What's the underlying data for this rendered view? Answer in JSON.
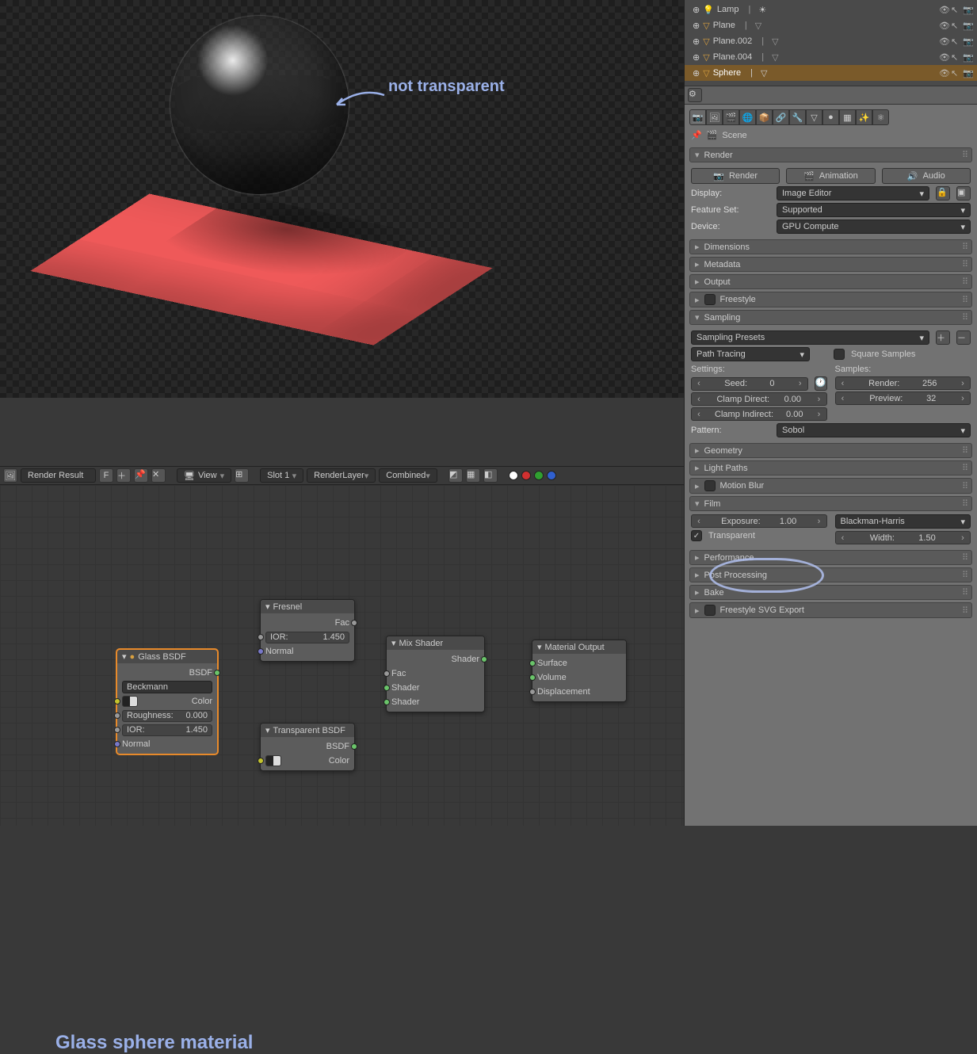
{
  "annotations": {
    "not_transparent": "not transparent",
    "material_title": "Glass sphere material"
  },
  "outliner": {
    "items": [
      {
        "name": "Lamp",
        "icon": "lamp"
      },
      {
        "name": "Plane",
        "icon": "mesh"
      },
      {
        "name": "Plane.002",
        "icon": "mesh"
      },
      {
        "name": "Plane.004",
        "icon": "mesh"
      },
      {
        "name": "Sphere",
        "icon": "mesh",
        "selected": true
      }
    ]
  },
  "node_toolbar": {
    "source_label": "Render Result",
    "f_label": "F",
    "view_label": "View",
    "slot_label": "Slot 1",
    "layer_label": "RenderLayer",
    "pass_label": "Combined"
  },
  "nodes": {
    "glass": {
      "title": "Glass BSDF",
      "out_bsdf": "BSDF",
      "distribution": "Beckmann",
      "color_label": "Color",
      "roughness_label": "Roughness:",
      "roughness_val": "0.000",
      "ior_label": "IOR:",
      "ior_val": "1.450",
      "normal_label": "Normal"
    },
    "fresnel": {
      "title": "Fresnel",
      "out_fac": "Fac",
      "ior_label": "IOR:",
      "ior_val": "1.450",
      "normal_label": "Normal"
    },
    "transparent": {
      "title": "Transparent BSDF",
      "out_bsdf": "BSDF",
      "color_label": "Color"
    },
    "mix": {
      "title": "Mix Shader",
      "out_shader": "Shader",
      "in_fac": "Fac",
      "in_shader1": "Shader",
      "in_shader2": "Shader"
    },
    "output": {
      "title": "Material Output",
      "surface": "Surface",
      "volume": "Volume",
      "displacement": "Displacement"
    }
  },
  "properties": {
    "breadcrumb": "Scene",
    "render": {
      "title": "Render",
      "render_btn": "Render",
      "animation_btn": "Animation",
      "audio_btn": "Audio",
      "display_label": "Display:",
      "display_val": "Image Editor",
      "featureset_label": "Feature Set:",
      "featureset_val": "Supported",
      "device_label": "Device:",
      "device_val": "GPU Compute"
    },
    "dimensions": "Dimensions",
    "metadata": "Metadata",
    "output": "Output",
    "freestyle": "Freestyle",
    "sampling": {
      "title": "Sampling",
      "preset": "Sampling Presets",
      "integrator": "Path Tracing",
      "square_samples": "Square Samples",
      "settings_label": "Settings:",
      "samples_label": "Samples:",
      "seed_label": "Seed:",
      "seed_val": "0",
      "clamp_direct_label": "Clamp Direct:",
      "clamp_direct_val": "0.00",
      "clamp_indirect_label": "Clamp Indirect:",
      "clamp_indirect_val": "0.00",
      "render_label": "Render:",
      "render_val": "256",
      "preview_label": "Preview:",
      "preview_val": "32",
      "pattern_label": "Pattern:",
      "pattern_val": "Sobol"
    },
    "geometry": "Geometry",
    "light_paths": "Light Paths",
    "motion_blur": "Motion Blur",
    "film": {
      "title": "Film",
      "exposure_label": "Exposure:",
      "exposure_val": "1.00",
      "transparent_label": "Transparent",
      "filter_val": "Blackman-Harris",
      "width_label": "Width:",
      "width_val": "1.50"
    },
    "performance": "Performance",
    "post_processing": "Post Processing",
    "bake": "Bake",
    "freestyle_svg": "Freestyle SVG Export"
  }
}
